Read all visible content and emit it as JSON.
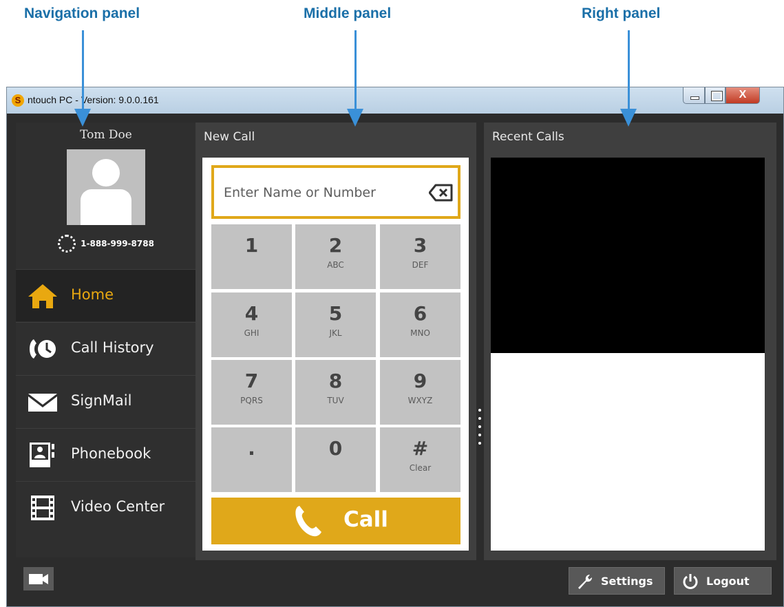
{
  "annotations": [
    {
      "label": "Navigation panel"
    },
    {
      "label": "Middle panel"
    },
    {
      "label": "Right panel"
    }
  ],
  "window": {
    "title": "ntouch PC  -  Version:  9.0.0.161",
    "app_icon": "ntouch-logo-icon",
    "controls": [
      "minimize-icon",
      "maximize-icon",
      "close-icon"
    ],
    "close_glyph": "X"
  },
  "user": {
    "name": "Tom Doe",
    "phone": "1-888-999-8788",
    "avatar_icon": "person-silhouette-icon"
  },
  "nav": {
    "items": [
      {
        "label": "Home",
        "icon": "home-icon",
        "active": true
      },
      {
        "label": "Call History",
        "icon": "call-history-icon",
        "active": false
      },
      {
        "label": "SignMail",
        "icon": "mail-icon",
        "active": false
      },
      {
        "label": "Phonebook",
        "icon": "phonebook-icon",
        "active": false
      },
      {
        "label": "Video Center",
        "icon": "film-icon",
        "active": false
      }
    ]
  },
  "new_call": {
    "title": "New Call",
    "search_placeholder": "Enter Name or Number",
    "keys": [
      {
        "digit": "1",
        "letters": ""
      },
      {
        "digit": "2",
        "letters": "ABC"
      },
      {
        "digit": "3",
        "letters": "DEF"
      },
      {
        "digit": "4",
        "letters": "GHI"
      },
      {
        "digit": "5",
        "letters": "JKL"
      },
      {
        "digit": "6",
        "letters": "MNO"
      },
      {
        "digit": "7",
        "letters": "PQRS"
      },
      {
        "digit": "8",
        "letters": "TUV"
      },
      {
        "digit": "9",
        "letters": "WXYZ"
      },
      {
        "digit": ".",
        "letters": ""
      },
      {
        "digit": "0",
        "letters": ""
      },
      {
        "digit": "#",
        "letters": "Clear"
      }
    ],
    "call_label": "Call"
  },
  "recent_calls": {
    "title": "Recent Calls"
  },
  "footer": {
    "settings_label": "Settings",
    "logout_label": "Logout"
  },
  "colors": {
    "accent": "#e0a81a",
    "panel_bg": "#3f3f3f",
    "window_bg": "#2c2c2c",
    "annotation_text": "#1a6fa8",
    "annotation_arrow": "#3a90d8"
  }
}
